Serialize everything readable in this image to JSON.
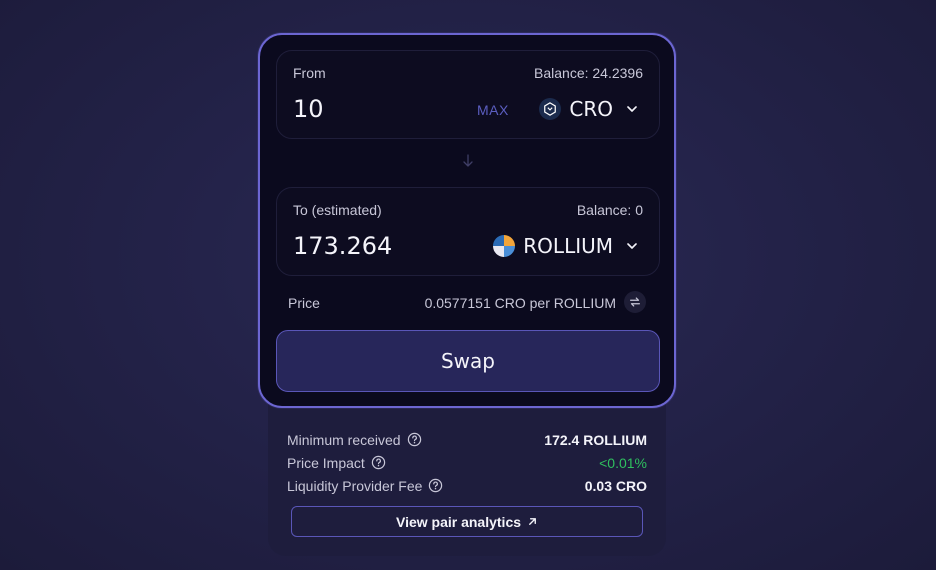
{
  "from": {
    "label": "From",
    "balance": "Balance: 24.2396",
    "amount": "10",
    "max_label": "MAX",
    "token": "CRO",
    "token_icon": "cro-logo-icon"
  },
  "to": {
    "label": "To (estimated)",
    "balance": "Balance: 0",
    "amount": "173.264",
    "token": "ROLLIUM",
    "token_icon": "rollium-logo-icon"
  },
  "price": {
    "label": "Price",
    "value": "0.0577151 CRO per ROLLIUM"
  },
  "swap_button": "Swap",
  "details": {
    "rows": [
      {
        "label": "Minimum received",
        "value": "172.4 ROLLIUM"
      },
      {
        "label": "Price Impact",
        "value": "<0.01%"
      },
      {
        "label": "Liquidity Provider Fee",
        "value": "0.03 CRO"
      }
    ],
    "analytics_link": "View pair analytics"
  },
  "colors": {
    "accent": "#6c66d2",
    "positive": "#2fbf5f",
    "max": "#5b5ec0"
  }
}
